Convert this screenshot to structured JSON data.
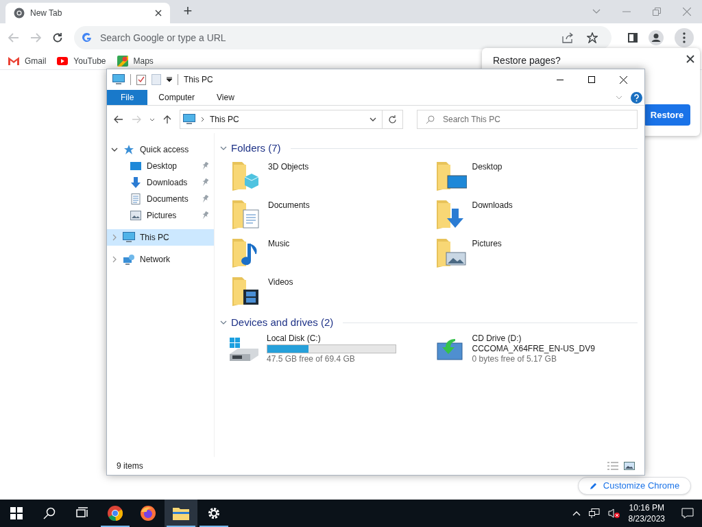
{
  "browser": {
    "tabs": [
      {
        "title": "New Tab",
        "selected": true
      }
    ],
    "new_tab": "+",
    "omnibox": {
      "placeholder": "Search Google or type a URL"
    },
    "bookmarks": [
      {
        "label": "Gmail",
        "kind": "gmail"
      },
      {
        "label": "YouTube",
        "kind": "youtube"
      },
      {
        "label": "Maps",
        "kind": "maps"
      }
    ],
    "restore_popup": {
      "title": "Restore pages?",
      "button": "Restore"
    },
    "customize_button": "Customize Chrome"
  },
  "explorer": {
    "title": "This PC",
    "ribbon_tabs": [
      {
        "label": "File",
        "selected": true
      },
      {
        "label": "Computer",
        "selected": false
      },
      {
        "label": "View",
        "selected": false
      }
    ],
    "address": "This PC",
    "search": {
      "placeholder": "Search This PC"
    },
    "nav": [
      {
        "label": "Quick access",
        "kind": "star",
        "expanded": true,
        "selected": false,
        "children": [
          {
            "label": "Desktop",
            "kind": "desktop",
            "pinned": true,
            "selected": false
          },
          {
            "label": "Downloads",
            "kind": "downloads",
            "pinned": true,
            "selected": false
          },
          {
            "label": "Documents",
            "kind": "documents",
            "pinned": true,
            "selected": false
          },
          {
            "label": "Pictures",
            "kind": "pictures",
            "pinned": true,
            "selected": false
          }
        ]
      },
      {
        "label": "This PC",
        "kind": "pc",
        "expanded": false,
        "selected": true
      },
      {
        "label": "Network",
        "kind": "network",
        "expanded": false,
        "selected": false
      }
    ],
    "folders": {
      "title": "Folders (7)",
      "expanded": true,
      "items": [
        {
          "name": "3D Objects",
          "kind": "cube"
        },
        {
          "name": "Desktop",
          "kind": "desktop"
        },
        {
          "name": "Documents",
          "kind": "documents"
        },
        {
          "name": "Downloads",
          "kind": "downloads"
        },
        {
          "name": "Music",
          "kind": "music"
        },
        {
          "name": "Pictures",
          "kind": "pictures"
        },
        {
          "name": "Videos",
          "kind": "videos"
        }
      ]
    },
    "drives": {
      "title": "Devices and drives (2)",
      "expanded": true,
      "items": [
        {
          "name": "Local Disk (C:)",
          "kind": "disk",
          "level": 0.32,
          "free": "47.5 GB free of 69.4 GB"
        },
        {
          "name": "CD Drive (D:)",
          "kind": "cd",
          "label": "CCCOMA_X64FRE_EN-US_DV9",
          "free": "0 bytes free of 5.17 GB"
        }
      ]
    },
    "status": "9 items"
  },
  "taskbar": {
    "apps": [
      {
        "kind": "start",
        "running": false,
        "selected": false
      },
      {
        "kind": "search",
        "running": false,
        "selected": false
      },
      {
        "kind": "taskview",
        "running": false,
        "selected": false
      },
      {
        "kind": "chrome",
        "running": true,
        "selected": false
      },
      {
        "kind": "firefox",
        "running": false,
        "selected": false
      },
      {
        "kind": "explorer",
        "running": true,
        "selected": true
      },
      {
        "kind": "settings",
        "running": true,
        "selected": false
      }
    ],
    "time": "10:16 PM",
    "date": "8/23/2023"
  }
}
